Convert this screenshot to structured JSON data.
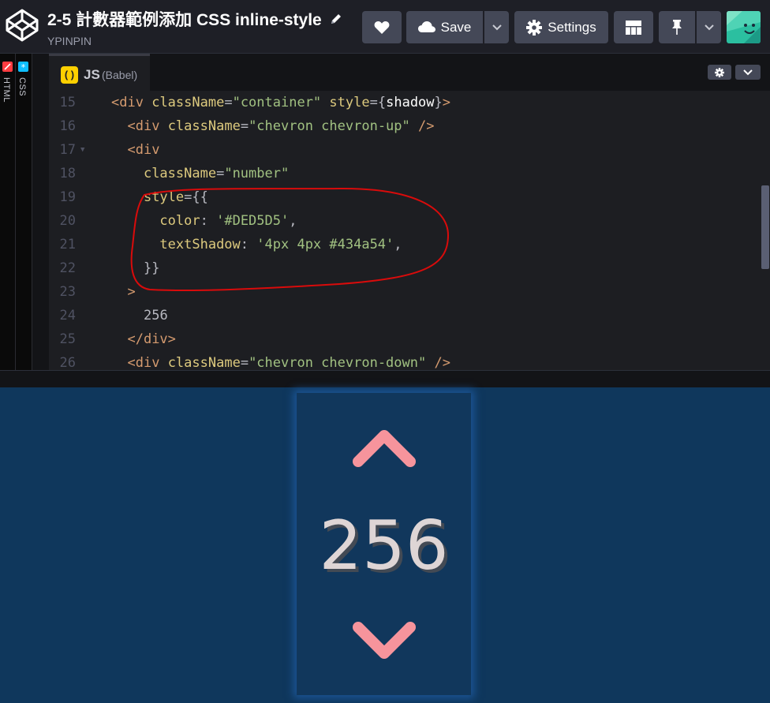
{
  "header": {
    "title": "2-5 計數器範例添加 CSS inline-style",
    "author": "YPINPIN",
    "save_label": "Save",
    "settings_label": "Settings"
  },
  "editor": {
    "collapsed_tabs": [
      {
        "label": "HTML",
        "color": "#ff3c41"
      },
      {
        "label": "CSS",
        "color": "#0ebeff"
      }
    ],
    "js_tab": {
      "label": "JS",
      "preprocessor": "(Babel)",
      "icon_text": "( )"
    },
    "code_lines": [
      {
        "n": "15",
        "fold": "",
        "text": "<div className=\"container\" style={shadow}>"
      },
      {
        "n": "16",
        "fold": "",
        "text": "  <div className=\"chevron chevron-up\" />"
      },
      {
        "n": "17",
        "fold": "▼",
        "text": "  <div"
      },
      {
        "n": "18",
        "fold": "",
        "text": "    className=\"number\""
      },
      {
        "n": "19",
        "fold": "",
        "text": "    style={{"
      },
      {
        "n": "20",
        "fold": "",
        "text": "      color: '#DED5D5',"
      },
      {
        "n": "21",
        "fold": "",
        "text": "      textShadow: '4px 4px #434a54',"
      },
      {
        "n": "22",
        "fold": "",
        "text": "    }}"
      },
      {
        "n": "23",
        "fold": "",
        "text": "  >"
      },
      {
        "n": "24",
        "fold": "",
        "text": "    256"
      },
      {
        "n": "25",
        "fold": "",
        "text": "  </div>"
      },
      {
        "n": "26",
        "fold": "",
        "text": "  <div className=\"chevron chevron-down\" />"
      }
    ]
  },
  "preview": {
    "number": "256",
    "number_color": "#DED5D5",
    "shadow_color": "#434a54",
    "chevron_color": "#f6949c",
    "background": "#0f375c"
  }
}
